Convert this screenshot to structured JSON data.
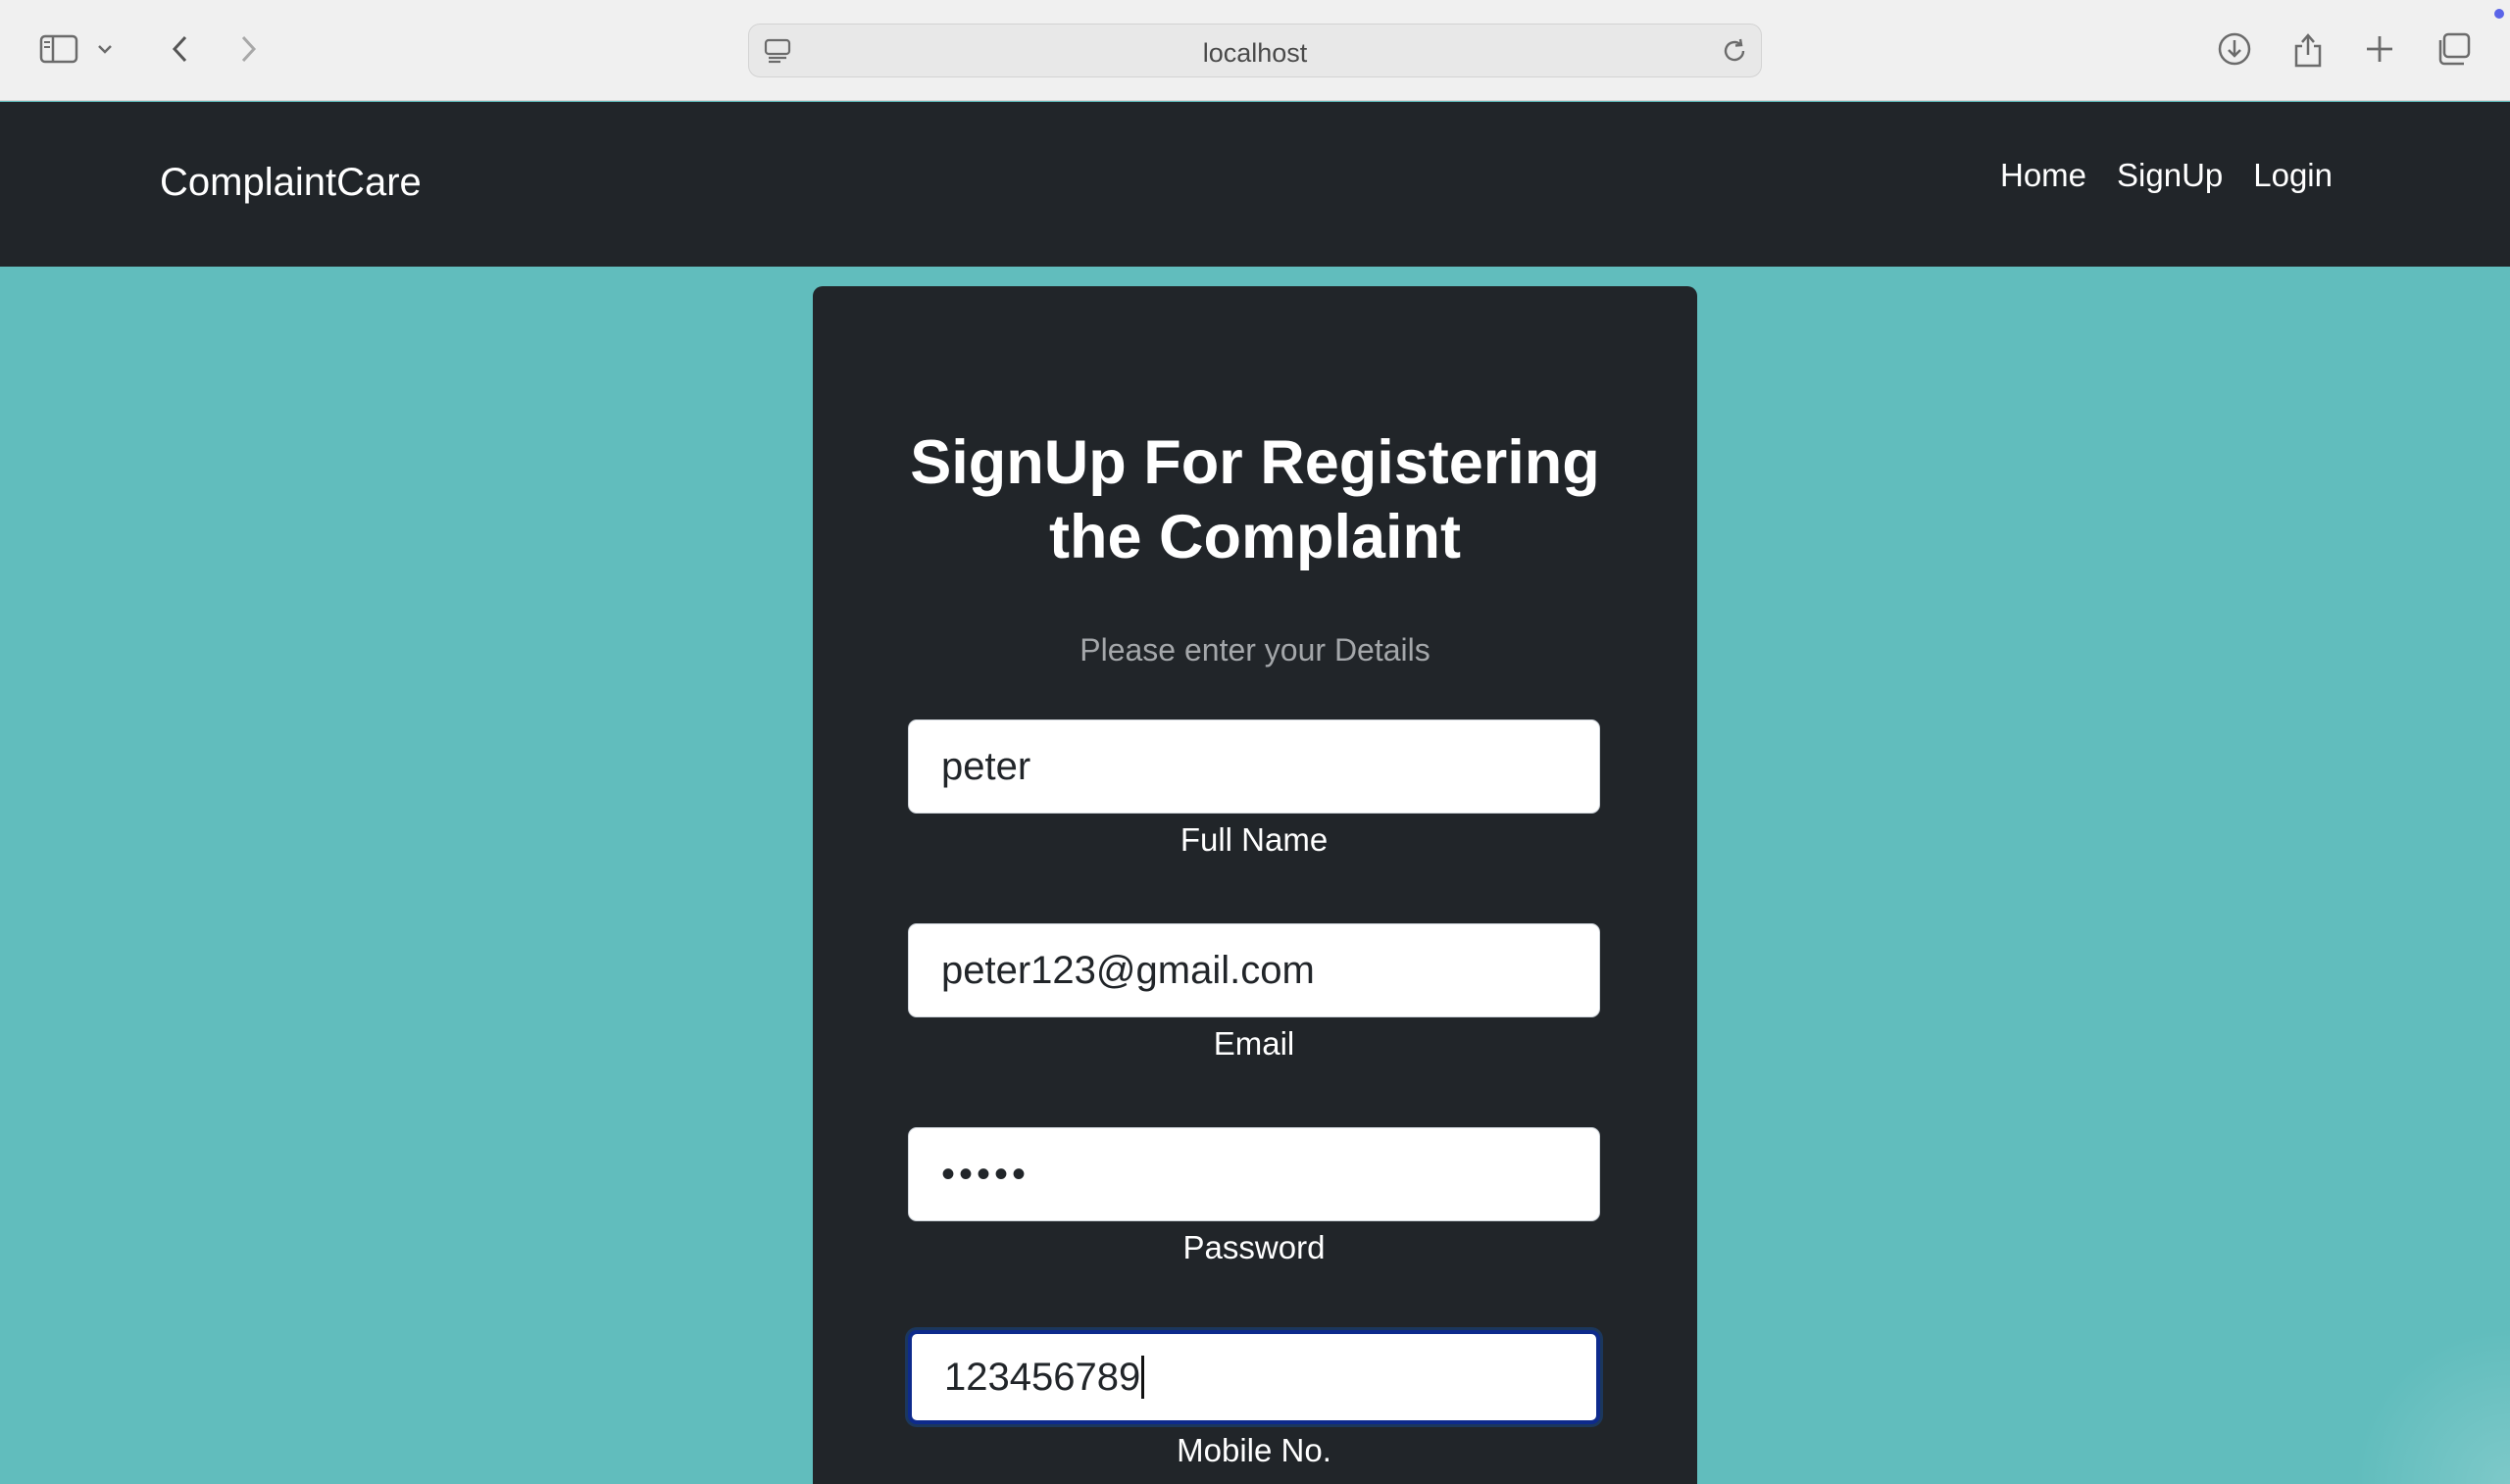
{
  "browser": {
    "url": "localhost",
    "icons": [
      "sidebar-icon",
      "chevron-down-icon",
      "back-icon",
      "forward-icon",
      "site-settings-icon",
      "reload-icon",
      "download-icon",
      "share-icon",
      "new-tab-icon",
      "tab-overview-icon"
    ]
  },
  "navbar": {
    "brand": "ComplaintCare",
    "links": [
      "Home",
      "SignUp",
      "Login"
    ]
  },
  "form": {
    "title": "SignUp For Registering the Complaint",
    "subtitle": "Please enter your Details",
    "fields": [
      {
        "value": "peter",
        "label": "Full Name"
      },
      {
        "value": "peter123@gmail.com",
        "label": "Email"
      },
      {
        "value": "•••••",
        "label": "Password"
      },
      {
        "value": "123456789",
        "label": "Mobile No."
      }
    ]
  },
  "colors": {
    "page_bg": "#61bdbd",
    "navbar_bg": "#212529",
    "card_bg": "#212529",
    "focus_border": "#0d2a8c"
  }
}
